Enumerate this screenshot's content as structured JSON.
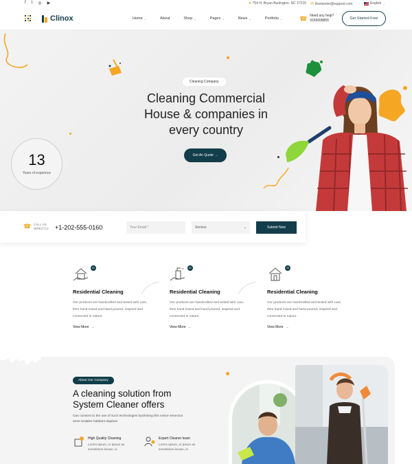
{
  "topbar": {
    "social": [
      "f",
      "t",
      "◎",
      "▶"
    ],
    "address": "754 H, Bryan Burlington, NC 27215",
    "email": "themevier@support.com",
    "language": "English"
  },
  "header": {
    "logo": "Clinox",
    "nav": [
      {
        "label": "Home",
        "dropdown": true
      },
      {
        "label": "About",
        "dropdown": false
      },
      {
        "label": "Shop",
        "dropdown": true
      },
      {
        "label": "Pages",
        "dropdown": true
      },
      {
        "label": "News",
        "dropdown": true
      },
      {
        "label": "Portfolio",
        "dropdown": true
      }
    ],
    "help_label": "Need any help?",
    "help_phone": "9159008855",
    "cta": "Get Started Free"
  },
  "hero": {
    "pill": "Cleaning Company",
    "title_line1": "Cleaning Commercial",
    "title_line2_pre": "House & ",
    "title_line2_hl": "companies",
    "title_line2_post": " in",
    "title_line3": "every country",
    "button": "Get An Quote →",
    "experience_number": "13",
    "experience_label": "Years of experince"
  },
  "contact": {
    "call_label": "CALL US DIRECTLY",
    "phone": "+1-202-555-0160",
    "email_placeholder": "Your Email *",
    "service": "Service",
    "submit": "Submit Now"
  },
  "services": [
    {
      "badge": "01",
      "title": "Residential Cleaning",
      "desc": "Our products are handcrafted and tested with care, then hand mixed and hand poured, inspired and connected to nature.",
      "more": "View More"
    },
    {
      "badge": "02",
      "title": "Residential Cleaning",
      "desc": "Our products are handcrafted and tested with care, then hand mixed and hand poured, inspired and connected to nature.",
      "more": "View More"
    },
    {
      "badge": "03",
      "title": "Residential Cleaning",
      "desc": "Our products are handcrafted and tested with care, then hand mixed and hand poured, inspired and connected to nature.",
      "more": "View More"
    }
  ],
  "about": {
    "pill": "About Our Company",
    "title_line1": "A cleaning solution from",
    "title_hl": "System",
    "title_rest": " Cleaner offers",
    "para": "Can consent to the use of such technologies bycilosing this notice senectus amet sodales habitant dapibus",
    "features": [
      {
        "title": "High Quality Cleaning",
        "desc": "Lorem Ipsum, or Ipsum as sometimes known, is"
      },
      {
        "title": "Expert Cleaner team",
        "desc": "Lorem Ipsum, or Ipsum as sometimes known, is"
      }
    ]
  },
  "colors": {
    "primary": "#123d4a",
    "accent": "#f5a623",
    "hero_bg": "#efefef"
  }
}
